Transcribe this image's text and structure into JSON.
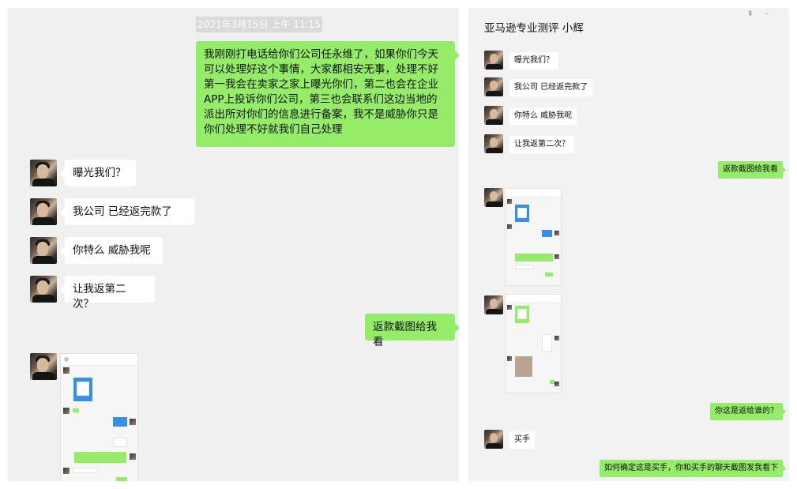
{
  "left_chat": {
    "timestamp": "2021年3月15日 上午 11:15",
    "messages": [
      {
        "from": "me",
        "text": "我刚刚打电话给你们公司任永维了，如果你们今天可以处理好这个事情，大家都相安无事，处理不好第一我会在卖家之家上曝光你们，第二也会在企业APP上投诉你们公司，第三也会联系们这边当地的派出所对你们的信息进行备案，我不是威胁你只是你们处理不好就我们自己处理"
      },
      {
        "from": "them",
        "text": "曝光我们？"
      },
      {
        "from": "them",
        "text": "我公司  已经返完款了"
      },
      {
        "from": "them",
        "text": "你特么  威胁我呢"
      },
      {
        "from": "them",
        "text": "让我返第二次？"
      },
      {
        "from": "me",
        "text": "返款截图给我看"
      }
    ]
  },
  "right_chat": {
    "title": "亚马逊专业测评  小辉",
    "window_controls": [
      "⇟",
      "–"
    ],
    "messages": [
      {
        "from": "them",
        "text": "曝光我们？"
      },
      {
        "from": "them",
        "text": "我公司  已经返完款了"
      },
      {
        "from": "them",
        "text": "你特么  威胁我呢"
      },
      {
        "from": "them",
        "text": "让我返第二次？"
      },
      {
        "from": "me",
        "text": "返款截图给我看"
      },
      {
        "from": "me",
        "text": "你这是返给谁的？"
      },
      {
        "from": "them",
        "text": "买手"
      },
      {
        "from": "me",
        "text": "如何确定这是买手，你和买手的聊天截图发我看下"
      }
    ]
  },
  "colors": {
    "outgoing_bubble": "#95ec69",
    "incoming_bubble": "#ffffff",
    "chat_background": "#f0f0f0",
    "timestamp_pill": "#dadada"
  }
}
